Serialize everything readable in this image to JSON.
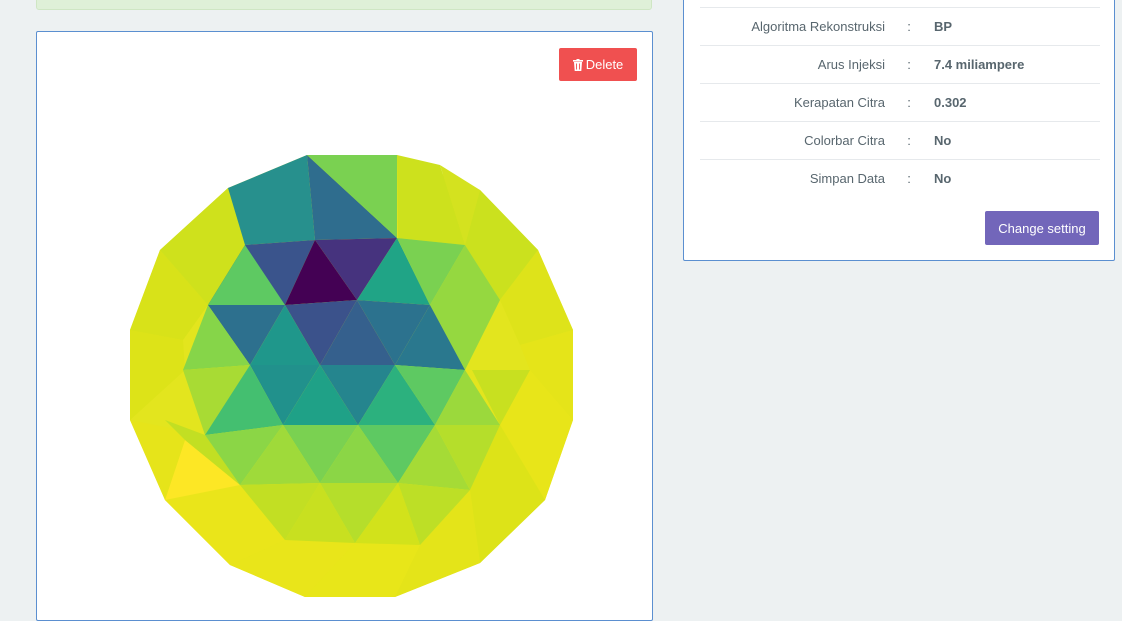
{
  "image_panel": {
    "delete_label": "Delete",
    "delete_icon": "trash-icon",
    "colormap": "viridis"
  },
  "settings": {
    "rows": [
      {
        "label": "Algoritma Rekonstruksi",
        "value": "BP"
      },
      {
        "label": "Arus Injeksi",
        "value": "7.4 miliampere"
      },
      {
        "label": "Kerapatan Citra",
        "value": "0.302"
      },
      {
        "label": "Colorbar Citra",
        "value": "No"
      },
      {
        "label": "Simpan Data",
        "value": "No"
      }
    ],
    "separator": ":",
    "change_label": "Change setting"
  },
  "colors": {
    "delete_button": "#f05050",
    "change_button": "#7266ba",
    "panel_border": "#5b8fd0",
    "page_background": "#edf1f2"
  }
}
